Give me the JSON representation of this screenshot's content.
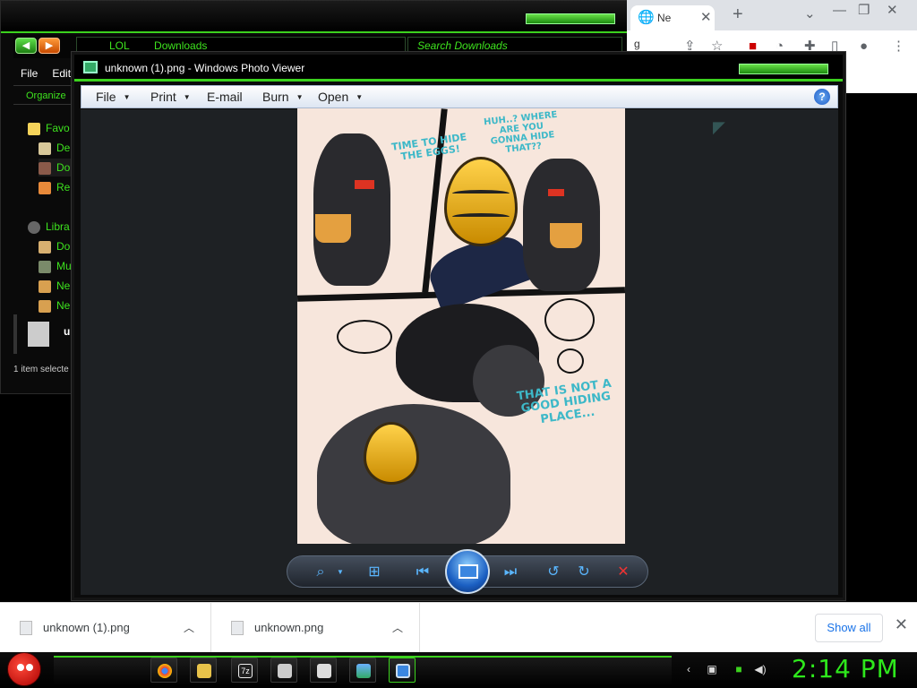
{
  "explorer": {
    "address": [
      "LOL",
      "Downloads"
    ],
    "search_placeholder": "Search Downloads",
    "menu": [
      "File",
      "Edit"
    ],
    "organize": "Organize",
    "nav_items": [
      "Favo",
      "De",
      "Do",
      "Re",
      "Libra",
      "Do",
      "Mu",
      "Ne",
      "Ne"
    ],
    "file_label": "unl",
    "status": "1 item selecte"
  },
  "chrome": {
    "tab_title": "Ne",
    "url_fragment": "g"
  },
  "viewer": {
    "title": "unknown (1).png - Windows Photo Viewer",
    "menu": [
      "File",
      "Print",
      "E-mail",
      "Burn",
      "Open"
    ],
    "help": "?",
    "comic": {
      "panel1_text": "TIME TO HIDE THE EGGS!",
      "panel2_text": "HUH..? WHERE ARE YOU GONNA HIDE THAT??",
      "panel3_text": "THAT IS NOT A GOOD HIDING PLACE..."
    }
  },
  "downloads": {
    "items": [
      {
        "name": "unknown (1).png"
      },
      {
        "name": "unknown.png"
      }
    ],
    "show_all": "Show all"
  },
  "taskbar": {
    "clock": "2:14 PM"
  },
  "colors": {
    "accent_green": "#3cd21e",
    "clock_green": "#2ee81c",
    "comic_text": "#3db8c8",
    "chrome_link": "#1a73e8"
  }
}
